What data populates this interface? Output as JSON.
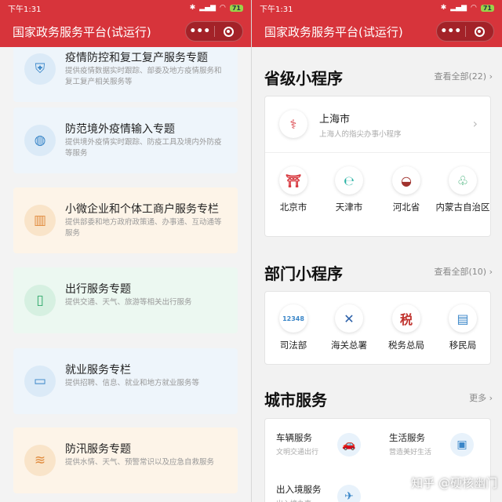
{
  "status_bar": {
    "time": "下午1:31",
    "battery": "71"
  },
  "navbar": {
    "title": "国家政务服务平台(试运行)",
    "more_glyph": "•••"
  },
  "left_panel": {
    "cards": [
      {
        "title": "疫情防控和复工复产服务专题",
        "desc": "提供疫情数据实时跟踪、部委及地方疫情服务和复工复产相关服务等",
        "icon": "shield-icon",
        "bg": "#eef5fb",
        "icon_bg": "#dbeaf7",
        "icon_color": "#3a86c8"
      },
      {
        "title": "防范境外疫情输入专题",
        "desc": "提供境外疫情实时跟踪、防疫工具及境内外防疫等服务",
        "icon": "globe-icon",
        "bg": "#eef5fb",
        "icon_bg": "#dbeaf7",
        "icon_color": "#3a86c8"
      },
      {
        "title": "小微企业和个体工商户服务专栏",
        "desc": "提供部委和地方政府政策通、办事通、互动通等服务",
        "icon": "building-icon",
        "bg": "#fdf4e8",
        "icon_bg": "#f9e4c9",
        "icon_color": "#e08a3c"
      },
      {
        "title": "出行服务专题",
        "desc": "提供交通、天气、旅游等相关出行服务",
        "icon": "luggage-icon",
        "bg": "#ecf8f1",
        "icon_bg": "#d6f0e1",
        "icon_color": "#2fa86a"
      },
      {
        "title": "就业服务专栏",
        "desc": "提供招聘、信息、就业和地方就业服务等",
        "icon": "briefcase-icon",
        "bg": "#eef5fb",
        "icon_bg": "#dbeaf7",
        "icon_color": "#3a86c8"
      },
      {
        "title": "防汛服务专题",
        "desc": "提供水情、天气、预警常识以及应急自救服务",
        "icon": "flood-icon",
        "bg": "#fdf4e8",
        "icon_bg": "#f9e4c9",
        "icon_color": "#e08a3c"
      }
    ]
  },
  "right_panel": {
    "provincial": {
      "title": "省级小程序",
      "more": "查看全部(22)",
      "featured": {
        "name": "上海市",
        "subtitle": "上海人的指尖办事小程序",
        "icon": "shanghai-icon"
      },
      "items": [
        {
          "name": "北京市",
          "icon": "tiananmen-icon",
          "color": "#d7343b",
          "glyph": "⛩"
        },
        {
          "name": "天津市",
          "icon": "tianjin-icon",
          "color": "#2bb3a5",
          "glyph": "℮"
        },
        {
          "name": "河北省",
          "icon": "hebei-icon",
          "color": "#a0322d",
          "glyph": "◒"
        },
        {
          "name": "内蒙古自治区",
          "icon": "neimenggu-icon",
          "color": "#2fa86a",
          "glyph": "♧"
        }
      ]
    },
    "departments": {
      "title": "部门小程序",
      "more": "查看全部(10)",
      "items": [
        {
          "name": "司法部",
          "icon": "justice-icon",
          "color": "#3a86c8",
          "glyph": "12348"
        },
        {
          "name": "海关总署",
          "icon": "customs-icon",
          "color": "#2a5fa8",
          "glyph": "✕"
        },
        {
          "name": "税务总局",
          "icon": "tax-icon",
          "color": "#c0332e",
          "glyph": "税"
        },
        {
          "name": "移民局",
          "icon": "immigration-icon",
          "color": "#3a86c8",
          "glyph": "▤"
        }
      ]
    },
    "city": {
      "title": "城市服务",
      "more": "更多",
      "items": [
        {
          "title": "车辆服务",
          "subtitle": "文明交通出行",
          "icon": "car-icon",
          "glyph": "🚗"
        },
        {
          "title": "生活服务",
          "subtitle": "营造美好生活",
          "icon": "life-icon",
          "glyph": "▣"
        },
        {
          "title": "出入境服务",
          "subtitle": "出入境办事",
          "icon": "plane-icon",
          "glyph": "✈"
        }
      ]
    },
    "watermark": "知乎 @硬核幽门"
  }
}
